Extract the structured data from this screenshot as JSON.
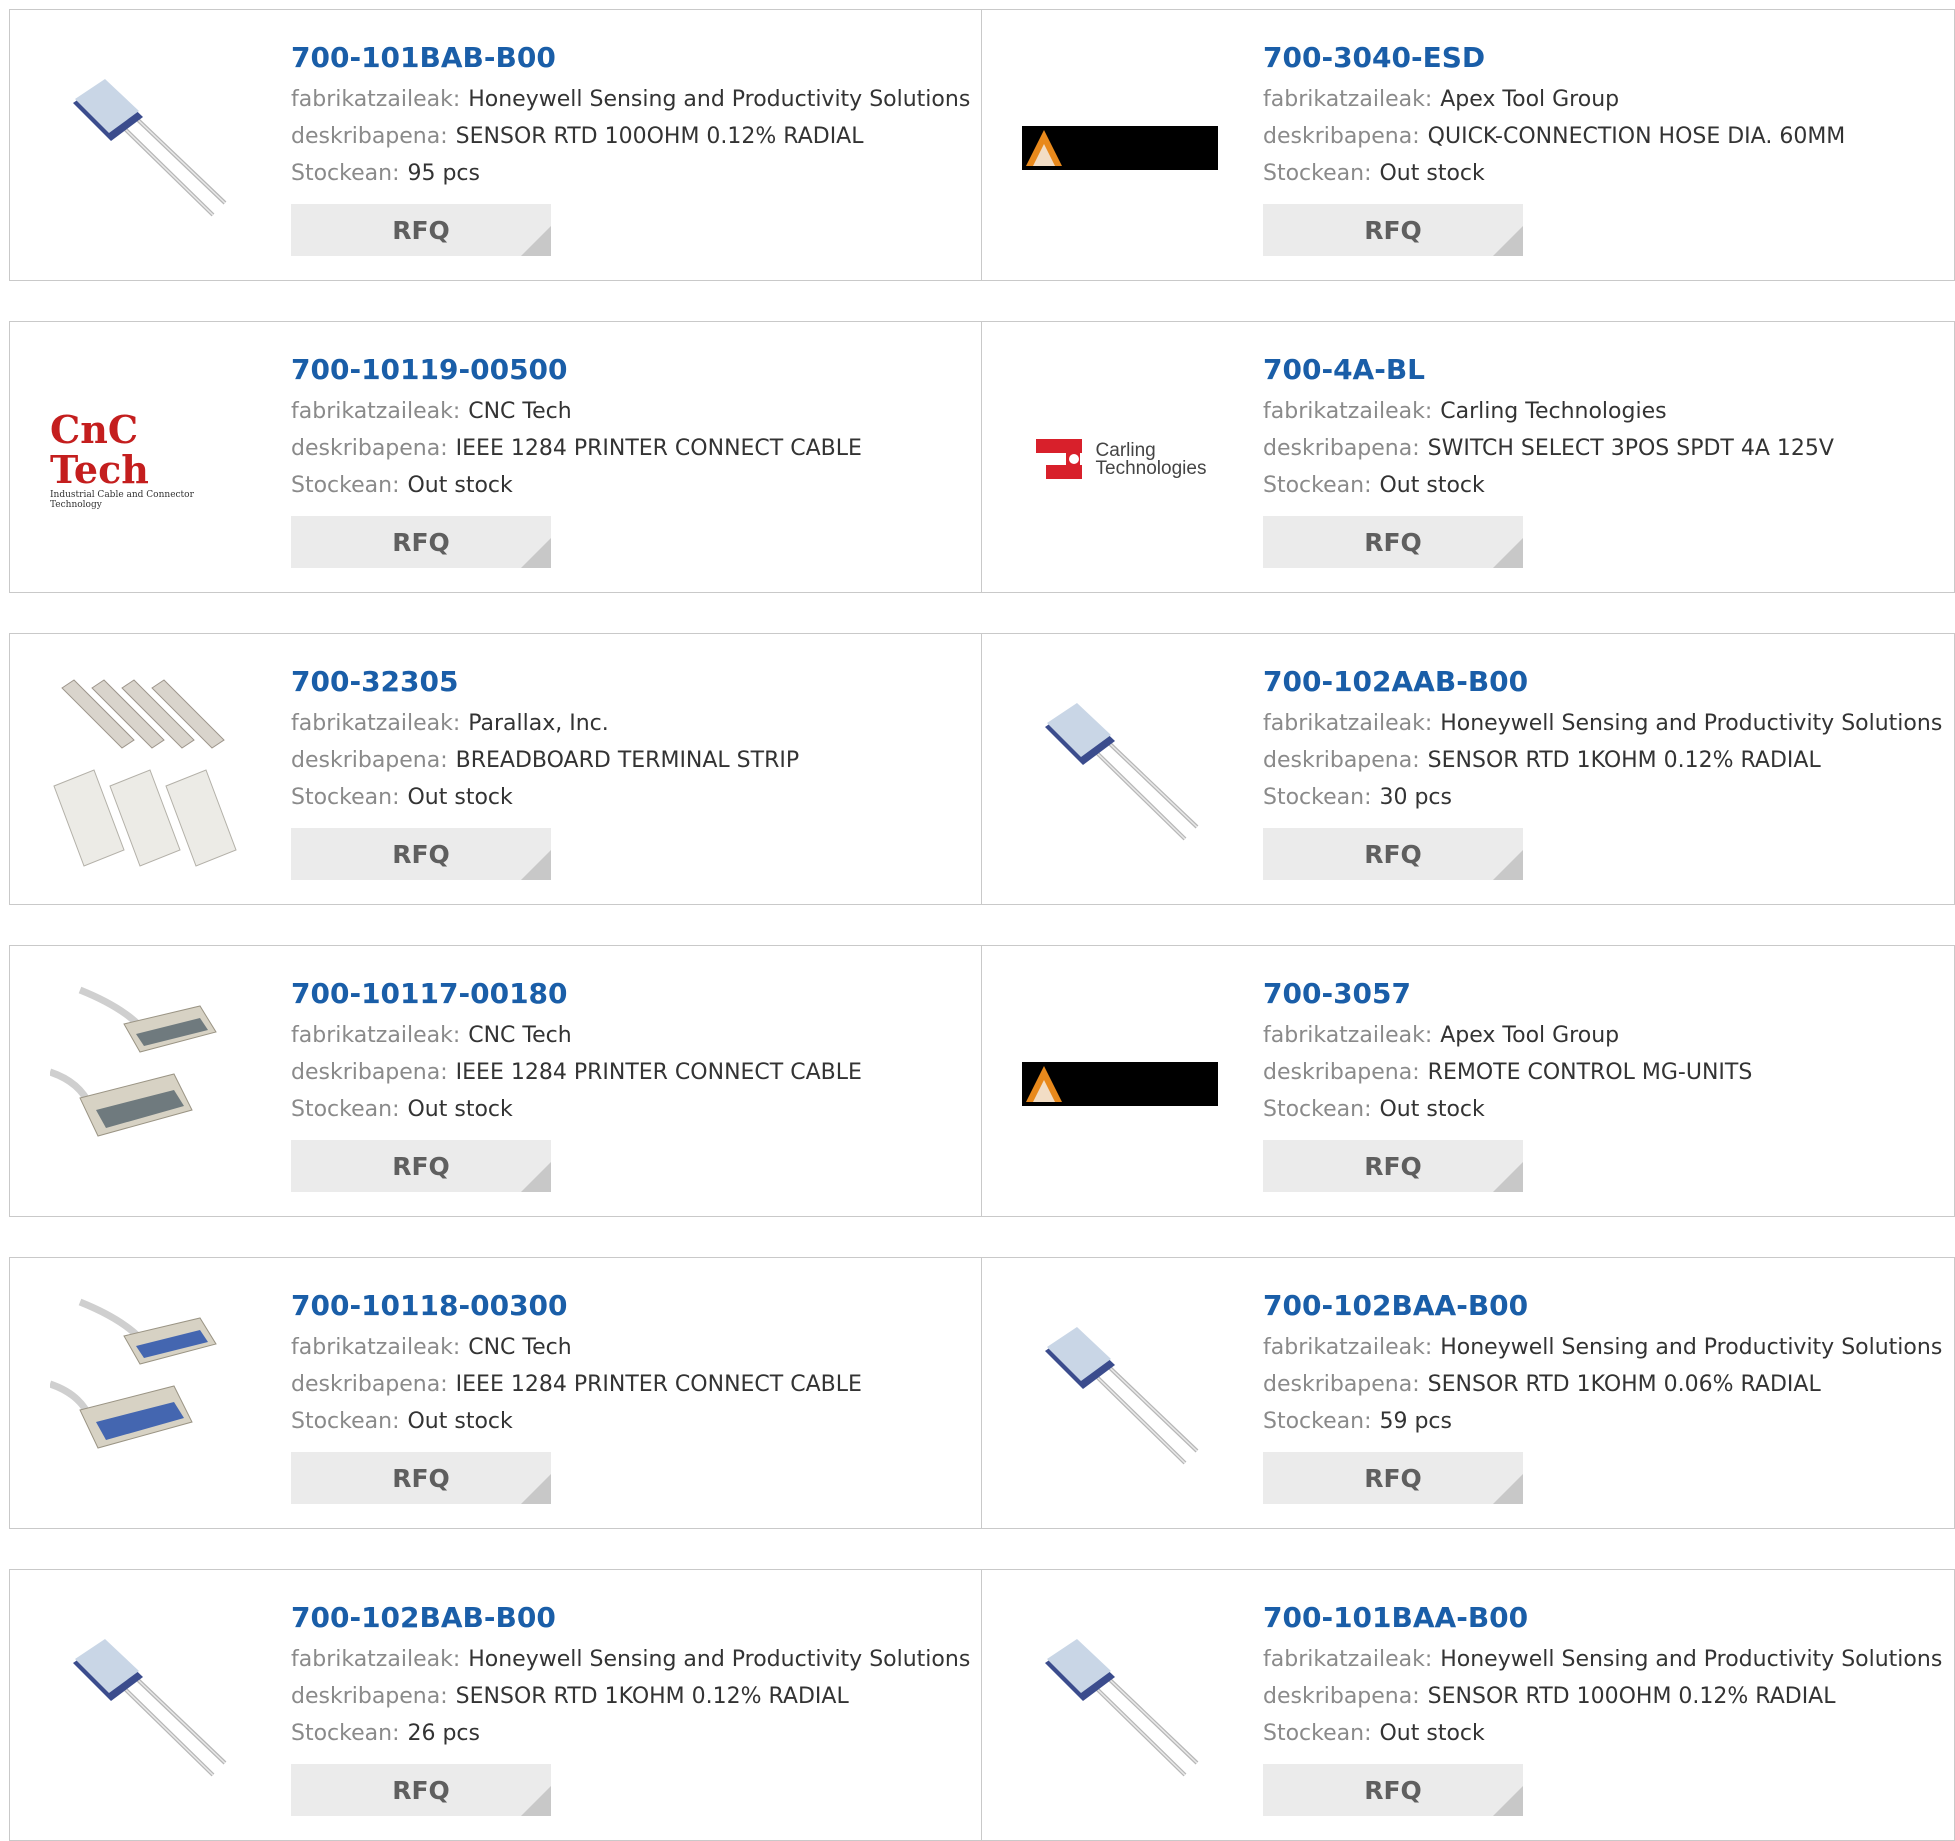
{
  "labels": {
    "manufacturer": "fabrikatzaileak:",
    "description": "deskribapena:",
    "stock": "Stockean:",
    "rfq": "RFQ"
  },
  "colors": {
    "part_number": "#1a5ea8",
    "label": "#8a8a8a",
    "rfq_bg": "#ebebeb",
    "border": "#c9c9c9"
  },
  "rows": [
    {
      "left": {
        "part": "700-101BAB-B00",
        "manufacturer": "Honeywell Sensing and Productivity Solutions",
        "description": "SENSOR RTD 100OHM 0.12% RADIAL",
        "stock": "95 pcs",
        "image": "rtd-sensor-image"
      },
      "right": {
        "part": "700-3040-ESD",
        "manufacturer": "Apex Tool Group",
        "description": "QUICK-CONNECTION HOSE DIA. 60MM",
        "stock": "Out stock",
        "image": "apex-logo"
      }
    },
    {
      "left": {
        "part": "700-10119-00500",
        "manufacturer": "CNC Tech",
        "description": "IEEE 1284 PRINTER CONNECT CABLE",
        "stock": "Out stock",
        "image": "cnc-tech-logo",
        "logo_text": "CnC Tech",
        "logo_subtext": "Industrial Cable and Connector Technology"
      },
      "right": {
        "part": "700-4A-BL",
        "manufacturer": "Carling Technologies",
        "description": "SWITCH SELECT 3POS SPDT 4A 125V",
        "stock": "Out stock",
        "image": "carling-logo",
        "logo_text_1": "Carling",
        "logo_text_2": "Technologies"
      }
    },
    {
      "left": {
        "part": "700-32305",
        "manufacturer": "Parallax, Inc.",
        "description": "BREADBOARD TERMINAL STRIP",
        "stock": "Out stock",
        "image": "breadboard-image"
      },
      "right": {
        "part": "700-102AAB-B00",
        "manufacturer": "Honeywell Sensing and Productivity Solutions",
        "description": "SENSOR RTD 1KOHM 0.12% RADIAL",
        "stock": "30 pcs",
        "image": "rtd-sensor-image"
      }
    },
    {
      "left": {
        "part": "700-10117-00180",
        "manufacturer": "CNC Tech",
        "description": "IEEE 1284 PRINTER CONNECT CABLE",
        "stock": "Out stock",
        "image": "db25-cable-image"
      },
      "right": {
        "part": "700-3057",
        "manufacturer": "Apex Tool Group",
        "description": "REMOTE CONTROL MG-UNITS",
        "stock": "Out stock",
        "image": "apex-logo"
      }
    },
    {
      "left": {
        "part": "700-10118-00300",
        "manufacturer": "CNC Tech",
        "description": "IEEE 1284 PRINTER CONNECT CABLE",
        "stock": "Out stock",
        "image": "centronics-cable-image"
      },
      "right": {
        "part": "700-102BAA-B00",
        "manufacturer": "Honeywell Sensing and Productivity Solutions",
        "description": "SENSOR RTD 1KOHM 0.06% RADIAL",
        "stock": "59 pcs",
        "image": "rtd-sensor-image"
      }
    },
    {
      "left": {
        "part": "700-102BAB-B00",
        "manufacturer": "Honeywell Sensing and Productivity Solutions",
        "description": "SENSOR RTD 1KOHM 0.12% RADIAL",
        "stock": "26 pcs",
        "image": "rtd-sensor-image"
      },
      "right": {
        "part": "700-101BAA-B00",
        "manufacturer": "Honeywell Sensing and Productivity Solutions",
        "description": "SENSOR RTD 100OHM 0.12% RADIAL",
        "stock": "Out stock",
        "image": "rtd-sensor-image"
      }
    }
  ]
}
